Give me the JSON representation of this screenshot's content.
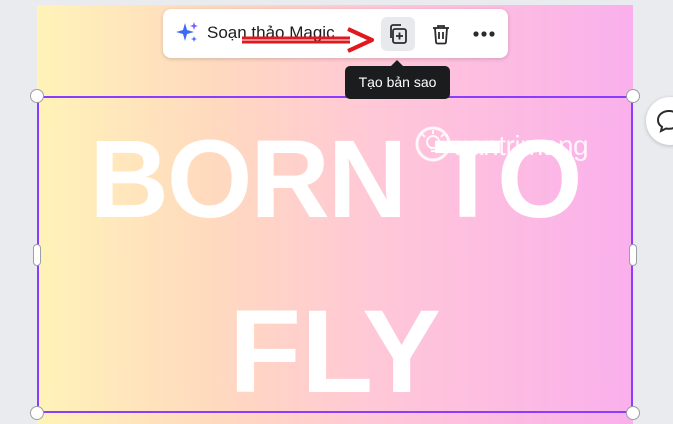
{
  "toolbar": {
    "magic_edit_label": "Soạn thảo Magic",
    "duplicate_icon": "duplicate-icon",
    "delete_icon": "trash-icon",
    "more_icon": "more-horizontal-icon"
  },
  "tooltip": {
    "text": "Tạo bản sao"
  },
  "canvas": {
    "text_line1": "BORN TO",
    "text_line2": "FLY",
    "gradient_colors": [
      "#fff3b8",
      "#ffc7d8",
      "#fab0ec"
    ]
  },
  "watermark": {
    "text": "uantrimang",
    "logo": "quantrimang-logo"
  },
  "colors": {
    "selection": "#8b3dff",
    "arrow": "#e0191f",
    "magic_accent": "#3d6bf5"
  },
  "side_button": {
    "icon": "comment-icon"
  }
}
